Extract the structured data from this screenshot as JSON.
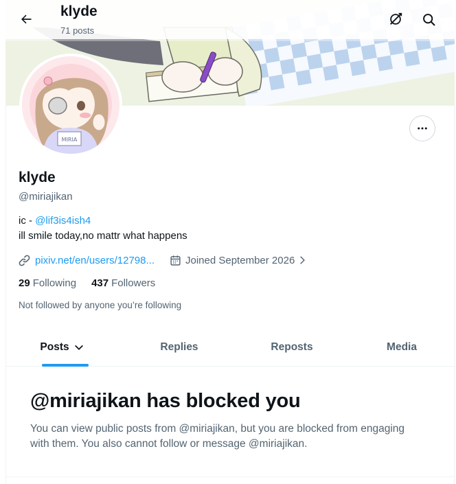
{
  "header": {
    "title": "klyde",
    "subtitle": "71 posts"
  },
  "profile": {
    "name": "klyde",
    "handle": "@miriajikan",
    "bio_prefix": "ic - ",
    "bio_link": "@lif3is4ish4",
    "bio_line2": "ill smile today,no mattr what happens",
    "website": "pixiv.net/en/users/12798...",
    "joined": "Joined September 2026",
    "following_count": "29",
    "following_label": "Following",
    "followers_count": "437",
    "followers_label": "Followers",
    "not_followed": "Not followed by anyone you’re following",
    "avatar_badge": "MIRIA"
  },
  "tabs": [
    {
      "label": "Posts",
      "active": true
    },
    {
      "label": "Replies",
      "active": false
    },
    {
      "label": "Reposts",
      "active": false
    },
    {
      "label": "Media",
      "active": false
    }
  ],
  "blocked": {
    "title": "@miriajikan has blocked you",
    "message": "You can view public posts from @miriajikan, but you are blocked from engaging with them. You also cannot follow or message @miriajikan."
  },
  "colors": {
    "accent": "#1d9bf0",
    "text": "#0f1419",
    "secondary": "#536471"
  },
  "icons": {
    "back": "arrow-left-icon",
    "translate": "no-sync-icon",
    "search": "search-icon",
    "more": "more-horizontal-icon",
    "link": "link-icon",
    "calendar": "calendar-icon",
    "chevron": "chevron-right-icon",
    "tab_dropdown": "chevron-down-icon"
  }
}
